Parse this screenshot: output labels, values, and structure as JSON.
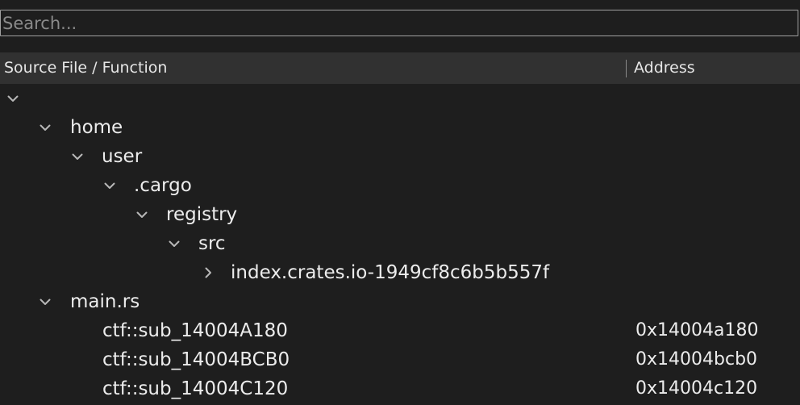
{
  "search": {
    "placeholder": "Search..."
  },
  "columns": {
    "source": "Source File / Function",
    "address": "Address"
  },
  "tree": {
    "root_label": "",
    "home": "home",
    "user": "user",
    "cargo": ".cargo",
    "registry": "registry",
    "src": "src",
    "crate": "index.crates.io-1949cf8c6b5b557f",
    "main": "main.rs",
    "functions": [
      {
        "name": "ctf::sub_14004A180",
        "address": "0x14004a180"
      },
      {
        "name": "ctf::sub_14004BCB0",
        "address": "0x14004bcb0"
      },
      {
        "name": "ctf::sub_14004C120",
        "address": "0x14004c120"
      }
    ]
  },
  "icons": {
    "expanded": "chevron-down-icon",
    "collapsed": "chevron-right-icon"
  },
  "colors": {
    "background": "#1e1e1e",
    "header": "#313131",
    "text": "#ececec",
    "chevron": "#b8b8b8"
  }
}
